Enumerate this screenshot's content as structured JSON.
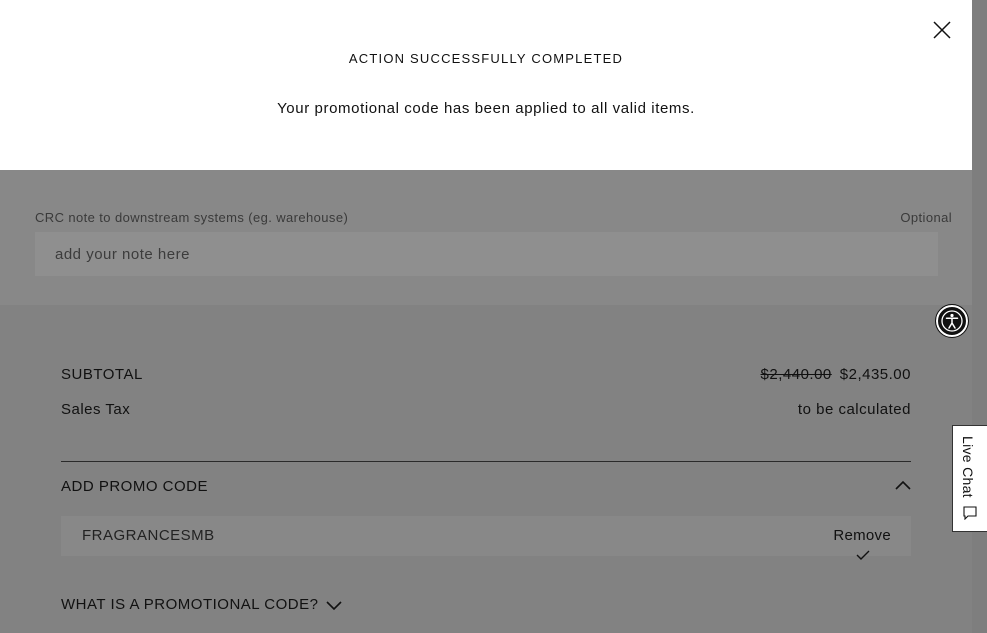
{
  "modal": {
    "title": "ACTION SUCCESSFULLY COMPLETED",
    "message": "Your promotional code has been applied to all valid items.",
    "close_icon": "close-icon"
  },
  "note": {
    "label": "CRC note to downstream systems (eg. warehouse)",
    "optional": "Optional",
    "placeholder": "add your note here",
    "value": ""
  },
  "summary": {
    "subtotal_label": "SUBTOTAL",
    "subtotal_original": "$2,440.00",
    "subtotal_discounted": "$2,435.00",
    "tax_label": "Sales Tax",
    "tax_value": "to be calculated"
  },
  "promo": {
    "header": "ADD PROMO CODE",
    "code": "FRAGRANCESMB",
    "remove_label": "Remove",
    "what_is": "WHAT IS A PROMOTIONAL CODE?"
  },
  "widgets": {
    "live_chat": "Live Chat",
    "accessibility_icon": "accessibility-icon"
  }
}
